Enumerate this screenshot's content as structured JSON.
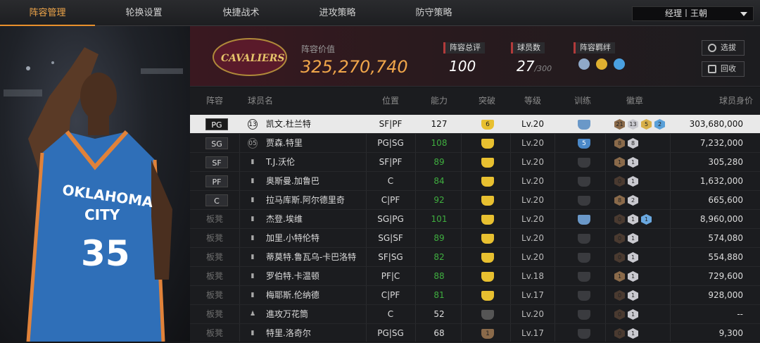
{
  "nav": {
    "tabs": [
      "阵容管理",
      "轮换设置",
      "快捷战术",
      "进攻策略",
      "防守策略"
    ],
    "manager_label": "经理丨王朝"
  },
  "header": {
    "team_logo_text": "CAVALIERS",
    "value_label": "阵容价值",
    "value": "325,270,740",
    "rating_label": "阵容总评",
    "rating": "100",
    "count_label": "球员数",
    "count": "27",
    "count_max": "/300",
    "bond_label": "阵容羁绊",
    "btn_pick": "选拔",
    "btn_recycle": "回收"
  },
  "columns": [
    "阵容",
    "球员名",
    "位置",
    "能力",
    "突破",
    "等级",
    "训练",
    "徽章",
    "球员身价"
  ],
  "colors": {
    "accent": "#e8902c",
    "green": "#3fae3f",
    "gold": "#e8c030",
    "value_orange": "#f0a64a"
  },
  "players": [
    {
      "slot": "PG",
      "name": "凯文.杜兰特",
      "num": "13",
      "pos": "SF|PF",
      "ability": "127",
      "breakthrough": "6",
      "level": "Lv.20",
      "training": "crown",
      "badges": [
        "21",
        "13",
        "5",
        "2"
      ],
      "price": "303,680,000"
    },
    {
      "slot": "SG",
      "name": "贾森.特里",
      "num": "05",
      "pos": "PG|SG",
      "ability": "108",
      "breakthrough": "crown",
      "level": "Lv.20",
      "training": "5",
      "badges": [
        "8",
        "8"
      ],
      "price": "7,232,000"
    },
    {
      "slot": "SF",
      "name": "T.J.沃伦",
      "num": "bars",
      "pos": "SF|PF",
      "ability": "89",
      "breakthrough": "crown",
      "level": "Lv.20",
      "training": "",
      "badges": [
        "1",
        "1"
      ],
      "price": "305,280"
    },
    {
      "slot": "PF",
      "name": "奥斯曼.加鲁巴",
      "num": "bars",
      "pos": "C",
      "ability": "84",
      "breakthrough": "crown",
      "level": "Lv.20",
      "training": "",
      "badges": [
        "0",
        "1"
      ],
      "price": "1,632,000"
    },
    {
      "slot": "C",
      "name": "拉马库斯.阿尔德里奇",
      "num": "bars",
      "pos": "C|PF",
      "ability": "92",
      "breakthrough": "crown",
      "level": "Lv.20",
      "training": "",
      "badges": [
        "8",
        "2"
      ],
      "price": "665,600"
    },
    {
      "slot": "板凳",
      "name": "杰登.埃维",
      "num": "bars",
      "pos": "SG|PG",
      "ability": "101",
      "breakthrough": "crown",
      "level": "Lv.20",
      "training": "crown",
      "badges": [
        "0",
        "1",
        "1"
      ],
      "price": "8,960,000"
    },
    {
      "slot": "板凳",
      "name": "加里.小特伦特",
      "num": "bars",
      "pos": "SG|SF",
      "ability": "89",
      "breakthrough": "crown",
      "level": "Lv.20",
      "training": "",
      "badges": [
        "0",
        "1"
      ],
      "price": "574,080"
    },
    {
      "slot": "板凳",
      "name": "蒂莫特.鲁瓦乌-卡巴洛特",
      "num": "bars",
      "pos": "SF|SG",
      "ability": "82",
      "breakthrough": "crown",
      "level": "Lv.20",
      "training": "",
      "badges": [
        "0",
        "1"
      ],
      "price": "554,880"
    },
    {
      "slot": "板凳",
      "name": "罗伯特.卡温顿",
      "num": "bars",
      "pos": "PF|C",
      "ability": "88",
      "breakthrough": "crown",
      "level": "Lv.18",
      "training": "",
      "badges": [
        "1",
        "1"
      ],
      "price": "729,600"
    },
    {
      "slot": "板凳",
      "name": "梅耶斯.伦纳德",
      "num": "bars",
      "pos": "C|PF",
      "ability": "81",
      "breakthrough": "crown",
      "level": "Lv.17",
      "training": "",
      "badges": [
        "0",
        "1"
      ],
      "price": "928,000"
    },
    {
      "slot": "板凳",
      "name": "進攻万花筒",
      "num": "person",
      "pos": "C",
      "ability": "52",
      "breakthrough": "",
      "level": "Lv.20",
      "training": "",
      "badges": [
        "0",
        "1"
      ],
      "price": "--"
    },
    {
      "slot": "板凳",
      "name": "特里.洛奇尔",
      "num": "bars",
      "pos": "PG|SG",
      "ability": "68",
      "breakthrough": "1",
      "level": "Lv.17",
      "training": "",
      "badges": [
        "0",
        "1"
      ],
      "price": "9,300"
    }
  ]
}
